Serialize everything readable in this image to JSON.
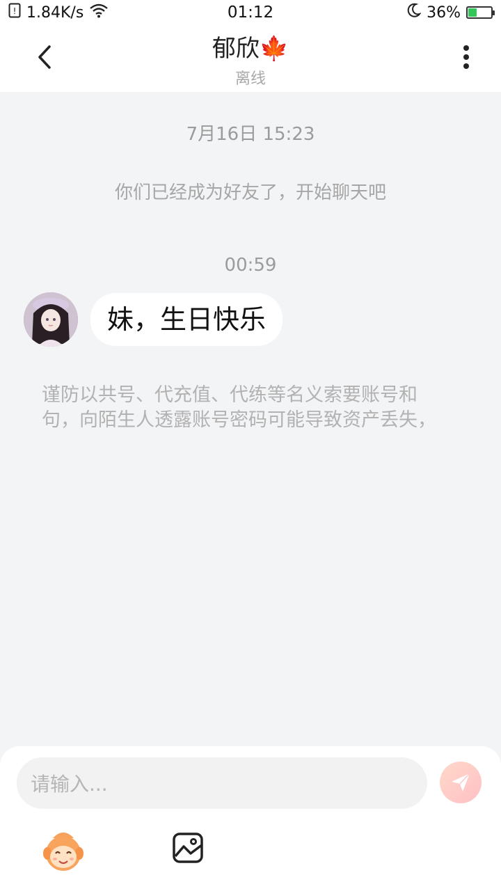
{
  "status_bar": {
    "network_speed": "1.84K/s",
    "time": "01:12",
    "battery_percent": "36%",
    "battery_level": 0.36,
    "icons": [
      "sim-icon",
      "wifi-icon",
      "moon-icon",
      "battery-icon"
    ]
  },
  "header": {
    "title": "郁欣🍁",
    "subtitle": "离线",
    "icons": [
      "back-arrow-icon",
      "more-dots-icon"
    ]
  },
  "chat": {
    "first_time": "7月16日 15:23",
    "system_message": "你们已经成为好友了，开始聊天吧",
    "second_time": "00:59",
    "message": {
      "text": "妹，生日快乐"
    },
    "notice_line1": "谨防以共号、代充值、代练等名义索要账号和",
    "notice_line2": "句，向陌生人透露账号密码可能导致资产丢失，"
  },
  "input": {
    "placeholder": "请输入..."
  },
  "colors": {
    "background": "#f3f4f6",
    "bubble": "#ffffff",
    "send_gradient_start": "#ffd9c8",
    "send_gradient_end": "#ffc0c6"
  }
}
